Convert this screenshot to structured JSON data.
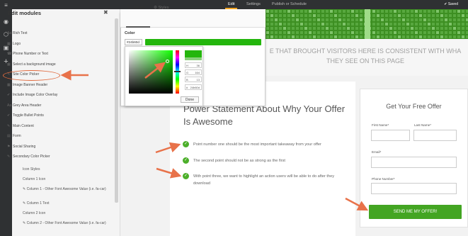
{
  "topbar": {
    "tabs": [
      "Edit",
      "Settings",
      "Publish or Schedule"
    ],
    "saved": "Saved"
  },
  "sidebar": {
    "title": "Edit modules",
    "items": [
      {
        "icon": "text-icon",
        "label": "Rich Text"
      },
      {
        "icon": "image-icon",
        "label": "Logo"
      },
      {
        "icon": "phone-icon",
        "label": "Phone Number or Text"
      },
      {
        "icon": "image-icon",
        "label": "Select a background image"
      },
      {
        "icon": "color-picker-icon",
        "label": "Site Color Picker"
      },
      {
        "icon": "image-icon",
        "label": "Image Banner Header"
      },
      {
        "icon": "check-icon",
        "label": "Include Image Color Overlay"
      },
      {
        "icon": "text-icon",
        "label": "Grey Area Header"
      },
      {
        "icon": "check-icon",
        "label": "Toggle Bullet Points"
      },
      {
        "icon": "edit-icon",
        "label": "Main Content"
      },
      {
        "icon": "form-icon",
        "label": "Form"
      },
      {
        "icon": "share-icon",
        "label": "Social Sharing"
      },
      {
        "icon": "color-picker-icon",
        "label": "Secondary Color Picker"
      }
    ],
    "subs": [
      {
        "label": "Icon Styles",
        "icon": false
      },
      {
        "label": "Column 1 Icon",
        "icon": false
      },
      {
        "label": "Column 1 - Other Font Awesome Value (i.e. fa-car)",
        "icon": true
      },
      {
        "label": "Column 1 Text",
        "icon": true
      },
      {
        "label": "Column 2 Icon",
        "icon": false
      },
      {
        "label": "Column 2 - Other Font Awesome Value (i.e. fa-car)",
        "icon": true
      }
    ]
  },
  "picker": {
    "tabs": [
      "Options",
      "Styles"
    ],
    "color_label": "Color",
    "hex_value": "#24b60d",
    "swatch_color": "#24b60d",
    "channels": [
      {
        "key": "H",
        "value": "36"
      },
      {
        "key": "G",
        "value": "164"
      },
      {
        "key": "B",
        "value": "13"
      },
      {
        "key": "#",
        "value": "24b60d"
      }
    ],
    "done_label": "Done"
  },
  "banner": {
    "text": "E THAT BROUGHT VISITORS HERE IS CONSISTENT WITH WHA\nTHEY SEE ON THIS PAGE"
  },
  "content": {
    "headline": "Power Statement About Why Your Offer Is Awesome",
    "points": [
      "Point number one should be the most important takeaway from your offer",
      "The second point should not be as strong as the first",
      "With point three, we want to highlight an action users will be able to do after they download"
    ]
  },
  "form": {
    "title": "Get Your Free Offer",
    "first_name": "First Name*",
    "last_name": "Last Name*",
    "email": "Email*",
    "phone": "Phone Number*",
    "submit": "SEND ME MY OFFER!"
  },
  "colors": {
    "accent": "#f5a623",
    "green": "#43a522",
    "arrow": "#e8724a"
  }
}
